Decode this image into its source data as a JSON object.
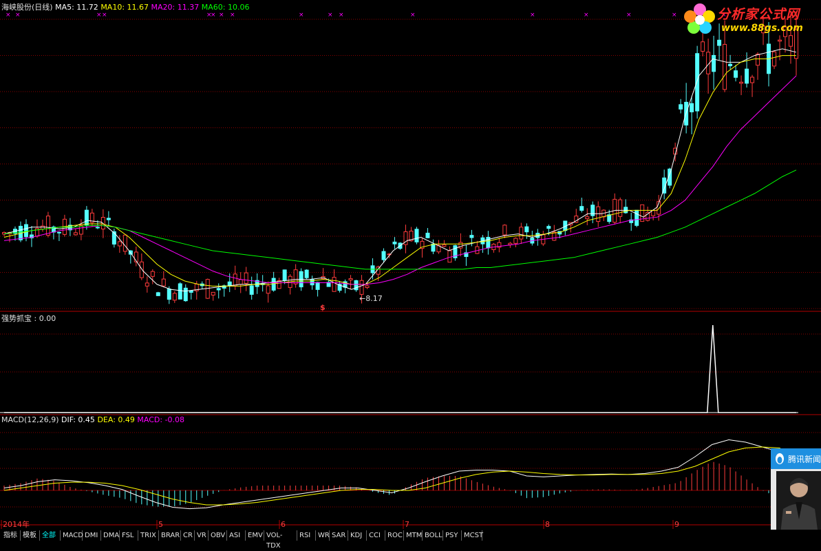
{
  "price_panel": {
    "title": "海峡股份(日线)",
    "ma5": "MA5: 11.72",
    "ma10": "MA10: 11.67",
    "ma20": "MA20: 11.37",
    "ma60": "MA60: 10.06",
    "low_marker": "8.17",
    "signal_mark": "$"
  },
  "indicator_panel": {
    "label": "强势抓宝 : 0.00"
  },
  "macd_panel": {
    "name": "MACD(12,26,9)",
    "dif": "DIF: 0.45",
    "dea": "DEA: 0.49",
    "macd": "MACD: -0.08"
  },
  "x_axis": {
    "labels": [
      "2014年",
      "5",
      "6",
      "7",
      "8",
      "9"
    ]
  },
  "tabs": [
    "指标",
    "模板",
    "全部",
    "MACD",
    "DMI",
    "DMA",
    "FSL",
    "TRIX",
    "BRAR",
    "CR",
    "VR",
    "OBV",
    "ASI",
    "EMV",
    "VOL-TDX",
    "RSI",
    "WR",
    "SAR",
    "KDJ",
    "CCI",
    "ROC",
    "MTM",
    "BOLL",
    "PSY",
    "MCST"
  ],
  "watermark": {
    "title": "分析家公式网",
    "url": "www.88gs.com"
  },
  "news_popup": {
    "title": "腾讯新闻"
  },
  "colors": {
    "up": "#ff3c3c",
    "down": "#54ffff",
    "ma5": "#ffffff",
    "ma10": "#ffff00",
    "ma20": "#ff00ff",
    "ma60": "#00ff00",
    "grid": "#8b0000"
  },
  "chart_data": [
    {
      "type": "line",
      "title": "海峡股份(日线)",
      "series": [
        {
          "name": "MA5",
          "values": [
            10.1,
            10.2,
            10.3,
            10.3,
            10.25,
            10.3,
            10.5,
            10.45,
            10.1,
            9.6,
            9.0,
            8.6,
            8.45,
            8.4,
            8.45,
            8.5,
            8.55,
            8.6,
            8.6,
            8.65,
            8.7,
            8.75,
            8.75,
            8.8,
            8.6,
            8.45,
            8.6,
            9.1,
            9.6,
            9.9,
            10.0,
            9.8,
            9.6,
            9.75,
            9.85,
            9.95,
            10.05,
            10.1,
            10.0,
            10.1,
            10.25,
            10.45,
            10.7,
            10.7,
            10.8,
            10.8,
            10.6,
            10.9,
            12.0,
            13.6,
            14.8,
            15.3,
            15.2,
            15.2,
            15.4,
            15.5,
            15.6,
            15.5
          ]
        },
        {
          "name": "MA10",
          "values": [
            10.0,
            10.1,
            10.2,
            10.25,
            10.3,
            10.35,
            10.4,
            10.4,
            10.3,
            10.0,
            9.6,
            9.2,
            8.9,
            8.7,
            8.6,
            8.55,
            8.55,
            8.55,
            8.6,
            8.6,
            8.65,
            8.7,
            8.7,
            8.75,
            8.7,
            8.6,
            8.6,
            8.8,
            9.1,
            9.4,
            9.7,
            9.8,
            9.8,
            9.8,
            9.85,
            9.9,
            10.0,
            10.05,
            10.05,
            10.1,
            10.15,
            10.3,
            10.5,
            10.6,
            10.7,
            10.8,
            10.8,
            10.8,
            11.3,
            12.3,
            13.5,
            14.3,
            14.9,
            15.2,
            15.3,
            15.3,
            15.4,
            15.4
          ]
        },
        {
          "name": "MA20",
          "values": [
            9.9,
            9.95,
            10.0,
            10.1,
            10.2,
            10.25,
            10.3,
            10.35,
            10.3,
            10.2,
            10.0,
            9.8,
            9.6,
            9.4,
            9.2,
            9.0,
            8.85,
            8.75,
            8.7,
            8.65,
            8.65,
            8.65,
            8.65,
            8.65,
            8.65,
            8.6,
            8.6,
            8.65,
            8.75,
            8.9,
            9.1,
            9.25,
            9.4,
            9.5,
            9.6,
            9.7,
            9.75,
            9.8,
            9.9,
            9.95,
            10.0,
            10.1,
            10.2,
            10.3,
            10.4,
            10.5,
            10.55,
            10.6,
            10.8,
            11.1,
            11.6,
            12.1,
            12.7,
            13.2,
            13.6,
            14.0,
            14.4,
            14.8
          ]
        },
        {
          "name": "MA60",
          "values": [
            10.1,
            10.15,
            10.2,
            10.25,
            10.3,
            10.3,
            10.35,
            10.35,
            10.3,
            10.2,
            10.1,
            10.0,
            9.9,
            9.8,
            9.7,
            9.6,
            9.55,
            9.5,
            9.45,
            9.4,
            9.35,
            9.3,
            9.25,
            9.2,
            9.15,
            9.1,
            9.05,
            9.05,
            9.05,
            9.05,
            9.05,
            9.05,
            9.05,
            9.05,
            9.1,
            9.1,
            9.15,
            9.2,
            9.25,
            9.3,
            9.35,
            9.4,
            9.5,
            9.6,
            9.7,
            9.8,
            9.9,
            10.0,
            10.15,
            10.3,
            10.5,
            10.7,
            10.9,
            11.1,
            11.3,
            11.55,
            11.8,
            12.0
          ]
        }
      ]
    },
    {
      "type": "line",
      "series": [
        {
          "name": "强势抓宝",
          "values": [
            0,
            0,
            0,
            0,
            0,
            0,
            0,
            0,
            0,
            0,
            0,
            0,
            0,
            0,
            0,
            0,
            0,
            0,
            0,
            0,
            0,
            0,
            0,
            0,
            0,
            0,
            0,
            0,
            0,
            0,
            0,
            0,
            0,
            0,
            0,
            0,
            0,
            0,
            0,
            0,
            0,
            0,
            0,
            0,
            0,
            0,
            0,
            0,
            0,
            0,
            0,
            1,
            0,
            0,
            0,
            0,
            0,
            0
          ]
        }
      ]
    },
    {
      "type": "line",
      "title": "MACD(12,26,9)",
      "series": [
        {
          "name": "DIF",
          "values": [
            0.05,
            0.1,
            0.18,
            0.22,
            0.2,
            0.16,
            0.1,
            0.02,
            -0.12,
            -0.25,
            -0.35,
            -0.38,
            -0.36,
            -0.3,
            -0.25,
            -0.2,
            -0.15,
            -0.1,
            -0.05,
            0.0,
            0.05,
            0.05,
            0.0,
            -0.05,
            0.05,
            0.18,
            0.3,
            0.4,
            0.42,
            0.42,
            0.4,
            0.3,
            0.28,
            0.3,
            0.32,
            0.33,
            0.34,
            0.33,
            0.35,
            0.4,
            0.48,
            0.7,
            0.95,
            1.05,
            1.0,
            0.9,
            0.8,
            0.55
          ]
        },
        {
          "name": "DEA",
          "values": [
            0.0,
            0.05,
            0.1,
            0.15,
            0.17,
            0.17,
            0.15,
            0.1,
            0.02,
            -0.08,
            -0.18,
            -0.25,
            -0.3,
            -0.3,
            -0.28,
            -0.25,
            -0.2,
            -0.15,
            -0.1,
            -0.05,
            0.0,
            0.02,
            0.02,
            0.0,
            0.0,
            0.05,
            0.15,
            0.25,
            0.33,
            0.38,
            0.4,
            0.38,
            0.35,
            0.33,
            0.32,
            0.32,
            0.33,
            0.33,
            0.33,
            0.35,
            0.4,
            0.5,
            0.65,
            0.8,
            0.88,
            0.9,
            0.88,
            0.7
          ]
        },
        {
          "name": "MACD",
          "values": [
            0.1,
            0.15,
            0.25,
            0.2,
            0.06,
            -0.02,
            -0.1,
            -0.16,
            -0.28,
            -0.34,
            -0.34,
            -0.26,
            -0.12,
            0.0,
            0.06,
            0.1,
            0.1,
            0.1,
            0.1,
            0.1,
            0.1,
            0.06,
            -0.04,
            -0.1,
            0.1,
            0.26,
            0.3,
            0.3,
            0.18,
            0.08,
            0.0,
            -0.16,
            -0.14,
            -0.06,
            0.0,
            0.02,
            0.02,
            0.0,
            0.04,
            0.1,
            0.16,
            0.4,
            0.6,
            0.5,
            0.24,
            0.0,
            -0.16,
            -0.3
          ]
        }
      ]
    }
  ]
}
